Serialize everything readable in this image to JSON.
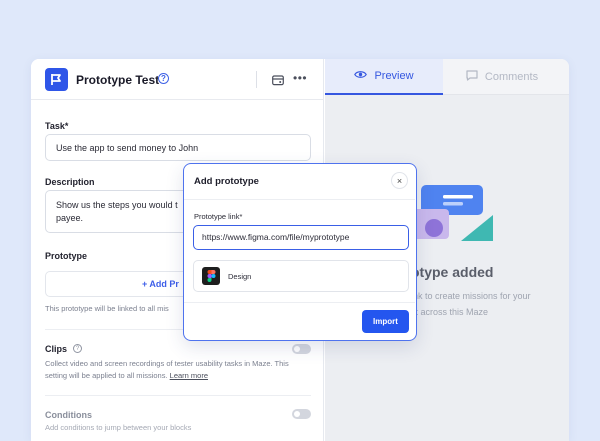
{
  "project": {
    "title": "Prototype Test",
    "help_icon": "?",
    "more_icon": "•••"
  },
  "tabs": [
    {
      "label": "Preview",
      "icon": "eye-icon"
    },
    {
      "label": "Comments",
      "icon": "comment-icon"
    }
  ],
  "task": {
    "label": "Task*",
    "value": "Use the app to send money to John"
  },
  "description": {
    "label": "Description",
    "value_line1": "Show us the steps you would t",
    "value_line2": "payee."
  },
  "prototype": {
    "label": "Prototype",
    "add_label": "+ Add Pr",
    "note": "This prototype will be linked to all mis"
  },
  "clips": {
    "label": "Clips",
    "info_icon": "?",
    "note_line1": "Collect video and screen recordings of tester usability tasks in Maze. This",
    "note_line2": "setting will be applied to all missions.",
    "link": "Learn more"
  },
  "conditions": {
    "label": "Conditions",
    "note": "Add conditions to jump between your blocks"
  },
  "preview": {
    "title": "otype added",
    "text_line1": "ink to create missions for your",
    "text_line2": "st across this Maze"
  },
  "modal": {
    "title": "Add prototype",
    "close_icon": "×",
    "link_label": "Prototype link*",
    "link_value": "https://www.figma.com/file/myprototype",
    "option_label": "Design",
    "import_label": "Import"
  },
  "colors": {
    "accent": "#2456ef",
    "brand": "#2f56e8",
    "background": "#dfe8fa"
  }
}
